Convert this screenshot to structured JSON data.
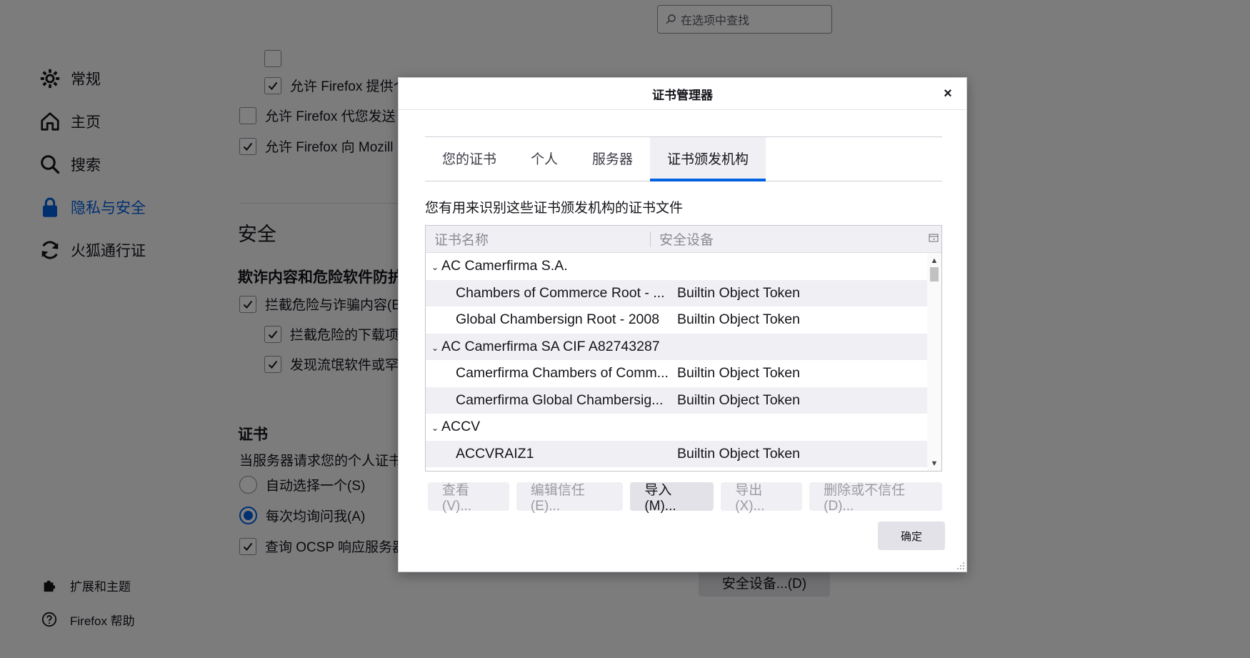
{
  "search": {
    "placeholder": "在选项中查找"
  },
  "sidebar": {
    "items": [
      {
        "label": "常规",
        "icon": "gear-icon"
      },
      {
        "label": "主页",
        "icon": "home-icon"
      },
      {
        "label": "搜索",
        "icon": "search-icon"
      },
      {
        "label": "隐私与安全",
        "icon": "lock-icon",
        "active": true
      },
      {
        "label": "火狐通行证",
        "icon": "sync-icon"
      }
    ],
    "footer": [
      {
        "label": "扩展和主题",
        "icon": "puzzle-icon"
      },
      {
        "label": "Firefox 帮助",
        "icon": "help-icon"
      }
    ]
  },
  "content": {
    "partial_row_1": "允许 Firefox 提供个",
    "partial_row_2": "允许 Firefox 代您发送",
    "partial_row_3": "允许 Firefox 向 Mozill",
    "security_title": "安全",
    "phishing_title": "欺诈内容和危险软件防护",
    "block_dangerous": "拦截危险与诈骗内容(B)",
    "block_downloads": "拦截危险的下载项(",
    "warn_unwanted": "发现流氓软件或罕见",
    "certs_title": "证书",
    "certs_desc": "当服务器请求您的个人证书",
    "auto_select": "自动选择一个(S)",
    "ask_every_time": "每次均询问我(A)",
    "ocsp": "查询 OCSP 响应服务器",
    "security_devices_button": "安全设备...(D)"
  },
  "dialog": {
    "title": "证书管理器",
    "tabs": [
      "您的证书",
      "个人",
      "服务器",
      "证书颁发机构"
    ],
    "active_tab": 3,
    "description": "您有用来识别这些证书颁发机构的证书文件",
    "columns": [
      "证书名称",
      "安全设备"
    ],
    "rows": [
      {
        "type": "group",
        "name": "AC Camerfirma S.A.",
        "device": ""
      },
      {
        "type": "child",
        "name": "Chambers of Commerce Root - ...",
        "device": "Builtin Object Token"
      },
      {
        "type": "child",
        "name": "Global Chambersign Root - 2008",
        "device": "Builtin Object Token"
      },
      {
        "type": "group",
        "name": "AC Camerfirma SA CIF A82743287",
        "device": ""
      },
      {
        "type": "child",
        "name": "Camerfirma Chambers of Comm...",
        "device": "Builtin Object Token"
      },
      {
        "type": "child",
        "name": "Camerfirma Global Chambersig...",
        "device": "Builtin Object Token"
      },
      {
        "type": "group",
        "name": "ACCV",
        "device": ""
      },
      {
        "type": "child",
        "name": "ACCVRAIZ1",
        "device": "Builtin Object Token"
      }
    ],
    "buttons": {
      "view": "查看(V)...",
      "edit_trust": "编辑信任(E)...",
      "import": "导入(M)...",
      "export": "导出(X)...",
      "delete_distrust": "删除或不信任(D)..."
    },
    "ok": "确定",
    "close": "×"
  }
}
